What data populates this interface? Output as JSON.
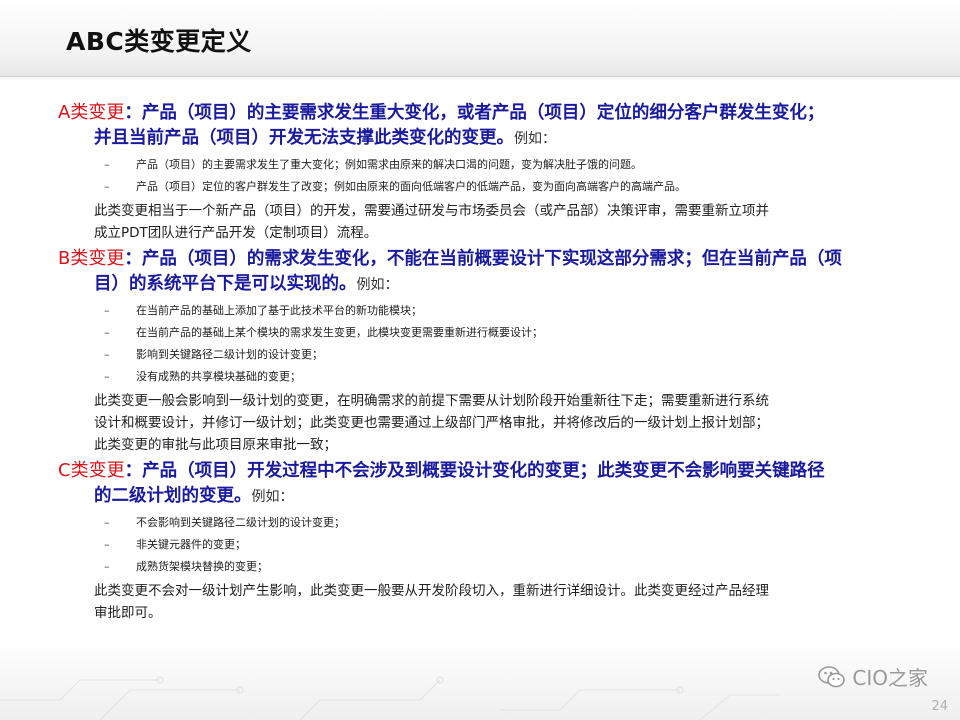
{
  "slide_title": "ABC类变更定义",
  "sections": [
    {
      "tag": "A类变更",
      "head_main": "：产品（项目）的主要需求发生重大变化，或者产品（项目）定位的细分客户群发生变化；",
      "head_cont": "并且当前产品（项目）开发无法支撑此类变化的变更。",
      "example": "例如：",
      "bullets": [
        "产品（项目）的主要需求发生了重大变化；例如需求由原来的解决口渴的问题，变为解决肚子饿的问题。",
        "产品（项目）定位的客户群发生了改变；例如由原来的面向低端客户的低端产品，变为面向高端客户的高端产品。"
      ],
      "paragraphs": [
        "此类变更相当于一个新产品（项目）的开发，需要通过研发与市场委员会（或产品部）决策评审，需要重新立项并",
        "成立PDT团队进行产品开发（定制项目）流程。"
      ]
    },
    {
      "tag": "B类变更",
      "head_main": "：产品（项目）的需求发生变化，不能在当前概要设计下实现这部分需求；但在当前产品（项",
      "head_cont": "目）的系统平台下是可以实现的。",
      "example": "例如：",
      "bullets": [
        "在当前产品的基础上添加了基于此技术平台的新功能模块；",
        "在当前产品的基础上某个模块的需求发生变更，此模块变更需要重新进行概要设计；",
        "影响到关键路径二级计划的设计变更；",
        "没有成熟的共享模块基础的变更；"
      ],
      "paragraphs": [
        "此类变更一般会影响到一级计划的变更，在明确需求的前提下需要从计划阶段开始重新往下走；需要重新进行系统",
        "设计和概要设计，并修订一级计划；此类变更也需要通过上级部门严格审批，并将修改后的一级计划上报计划部；",
        "此类变更的审批与此项目原来审批一致；"
      ]
    },
    {
      "tag": "C类变更",
      "head_main": "：产品（项目）开发过程中不会涉及到概要设计变化的变更；此类变更不会影响要关键路径",
      "head_cont": "的二级计划的变更。",
      "example": "例如：",
      "bullets": [
        "不会影响到关键路径二级计划的设计变更；",
        "非关键元器件的变更；",
        "成熟货架模块替换的变更；"
      ],
      "paragraphs": [
        "此类变更不会对一级计划产生影响，此类变更一般要从开发阶段切入，重新进行详细设计。此类变更经过产品经理",
        "审批即可。"
      ]
    }
  ],
  "bullet_dash": "–",
  "watermark_text": "CIO之家",
  "watermark_icon": "wechat-icon",
  "page_number": "24",
  "colors": {
    "tag": "#d9161c",
    "heading": "#1a1a9e",
    "body": "#222222"
  }
}
